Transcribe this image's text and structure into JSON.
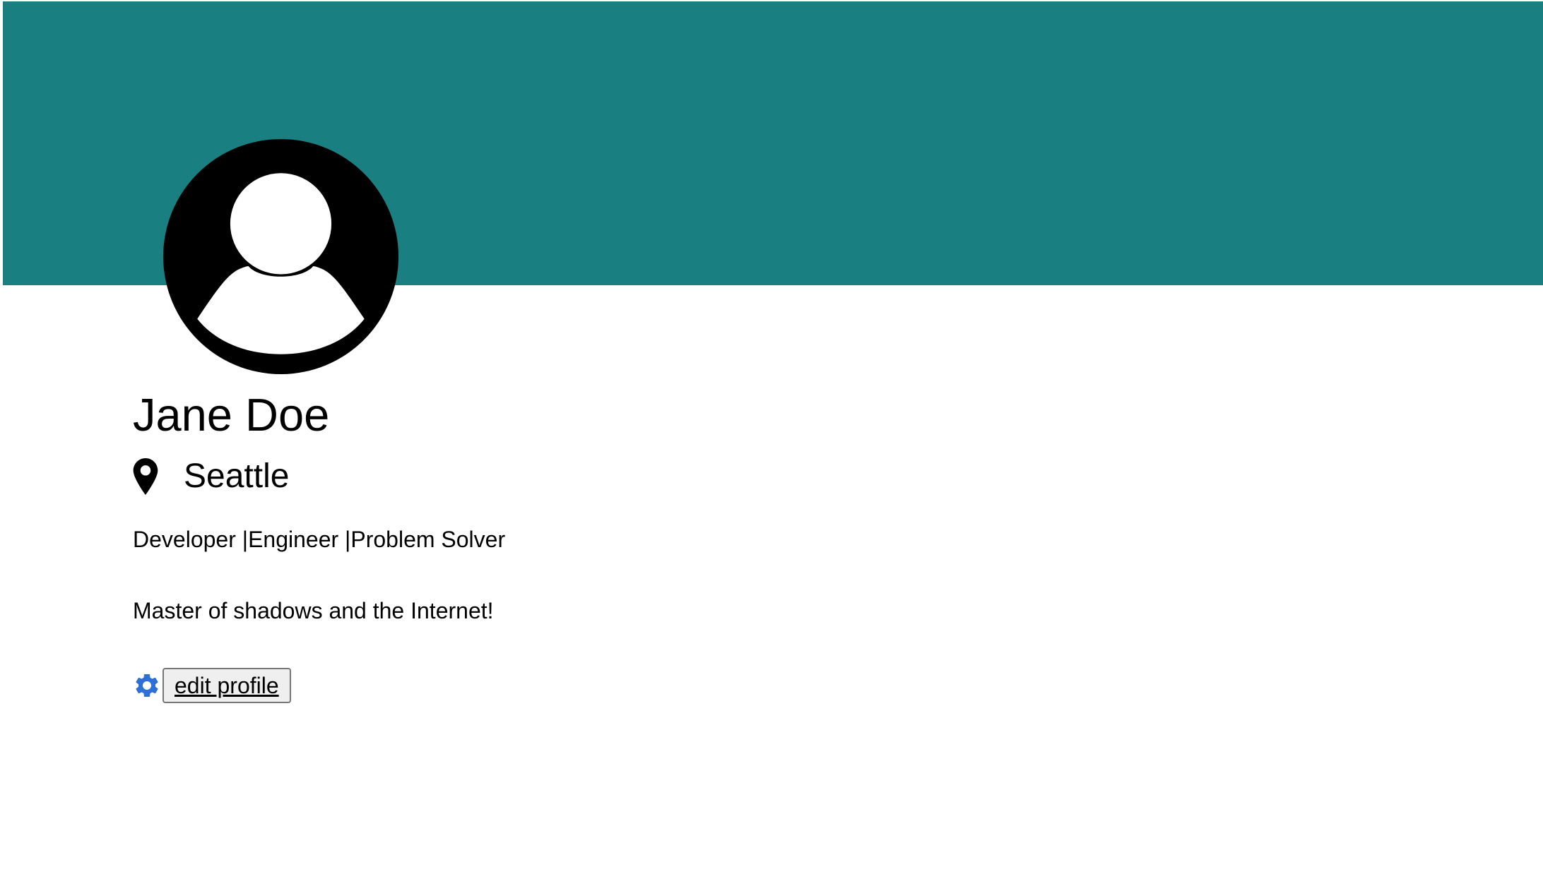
{
  "banner": {
    "color": "#1a7f80"
  },
  "avatar": {
    "icon": "user-avatar-icon"
  },
  "profile": {
    "name": "Jane Doe",
    "location": "Seattle",
    "location_icon": "map-pin-icon",
    "headline": "Developer |Engineer |Problem Solver",
    "bio": "Master of shadows and the Internet!"
  },
  "actions": {
    "edit_icon": "gear-icon",
    "edit_icon_color": "#2f6fd6",
    "edit_label": "edit profile"
  }
}
